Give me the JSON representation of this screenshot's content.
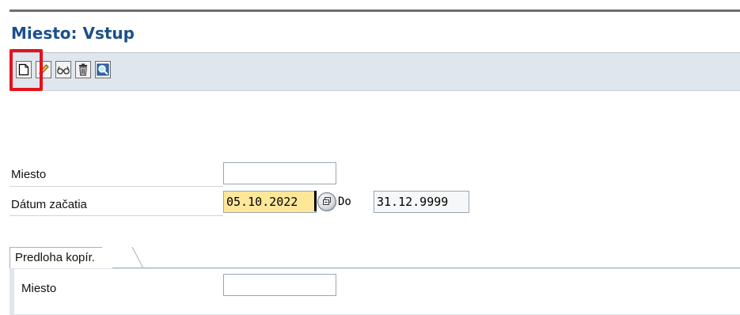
{
  "window": {
    "title": "Miesto: Vstup"
  },
  "toolbar": {
    "buttons": [
      {
        "name": "create-button",
        "icon": "new-document-icon",
        "highlighted": true
      },
      {
        "name": "change-button",
        "icon": "pencil-icon"
      },
      {
        "name": "display-button",
        "icon": "glasses-icon"
      },
      {
        "name": "delete-button",
        "icon": "trash-icon"
      },
      {
        "name": "find-button",
        "icon": "magnifier-icon"
      }
    ]
  },
  "form": {
    "location_label": "Miesto",
    "location_value": "",
    "start_date_label": "Dátum začatia",
    "start_date_value": "05.10.2022",
    "to_label": "Do",
    "end_date_value": "31.12.9999"
  },
  "copy_template": {
    "title": "Predloha kopír.",
    "location_label": "Miesto",
    "location_value": ""
  },
  "colors": {
    "title": "#1b4f8c",
    "toolbar_bg": "#dfe6ee",
    "highlight": "#e5121b",
    "active_field": "#ffe79a"
  }
}
